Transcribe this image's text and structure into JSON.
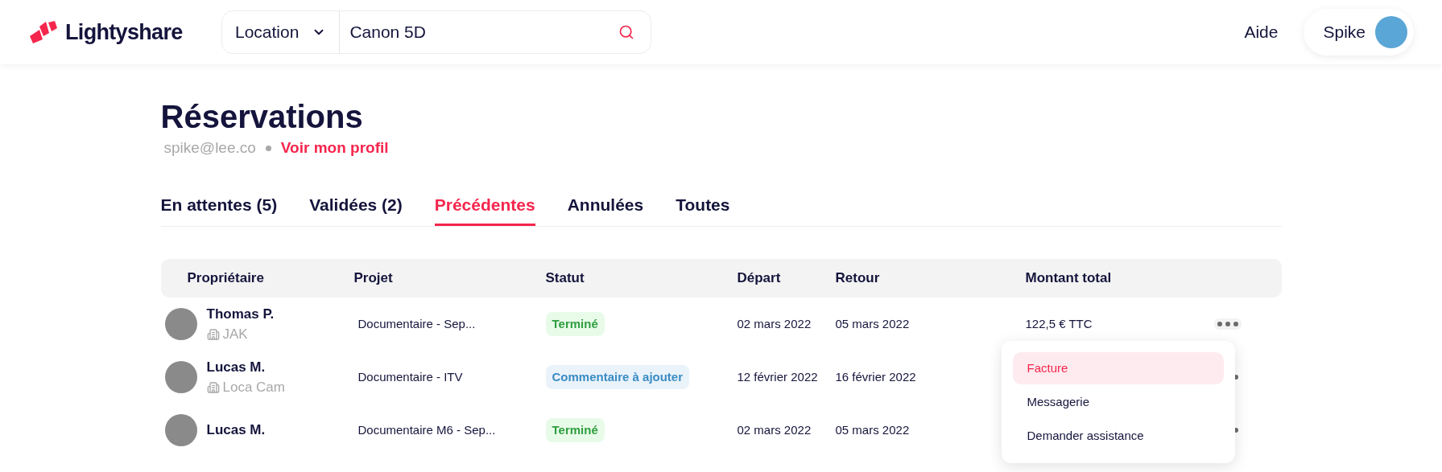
{
  "nav": {
    "brand": "Lightyshare",
    "search": {
      "category": "Location",
      "value": "Canon 5D"
    },
    "help": "Aide",
    "user": "Spike"
  },
  "header": {
    "title": "Réservations",
    "email": "spike@lee.co",
    "profile_link": "Voir mon profil"
  },
  "tabs": [
    {
      "label": "En attentes (5)",
      "selected": false
    },
    {
      "label": "Validées (2)",
      "selected": false
    },
    {
      "label": "Précédentes",
      "selected": true
    },
    {
      "label": "Annulées",
      "selected": false
    },
    {
      "label": "Toutes",
      "selected": false
    }
  ],
  "table": {
    "columns": [
      "Propriétaire",
      "Projet",
      "Statut",
      "Départ",
      "Retour",
      "Montant total"
    ],
    "rows": [
      {
        "owner": "Thomas P.",
        "company": "JAK",
        "project": "Documentaire  - Sep...",
        "status": {
          "label": "Terminé",
          "kind": "done"
        },
        "departure": "02 mars 2022",
        "return": "05 mars 2022",
        "amount": "122,5 € TTC",
        "menu_open": true
      },
      {
        "owner": "Lucas M.",
        "company": "Loca Cam",
        "project": "Documentaire - ITV",
        "status": {
          "label": "Commentaire à ajouter",
          "kind": "comment"
        },
        "departure": "12 février 2022",
        "return": "16 février 2022",
        "menu_open": false
      },
      {
        "owner": "Lucas M.",
        "project": "Documentaire M6 - Sep...",
        "status": {
          "label": "Terminé",
          "kind": "done"
        },
        "departure": "02 mars 2022",
        "return": "05 mars 2022",
        "menu_open": false
      }
    ]
  },
  "row_menu": [
    {
      "label": "Facture",
      "selected": true
    },
    {
      "label": "Messagerie",
      "selected": false
    },
    {
      "label": "Demander assistance",
      "selected": false
    }
  ]
}
